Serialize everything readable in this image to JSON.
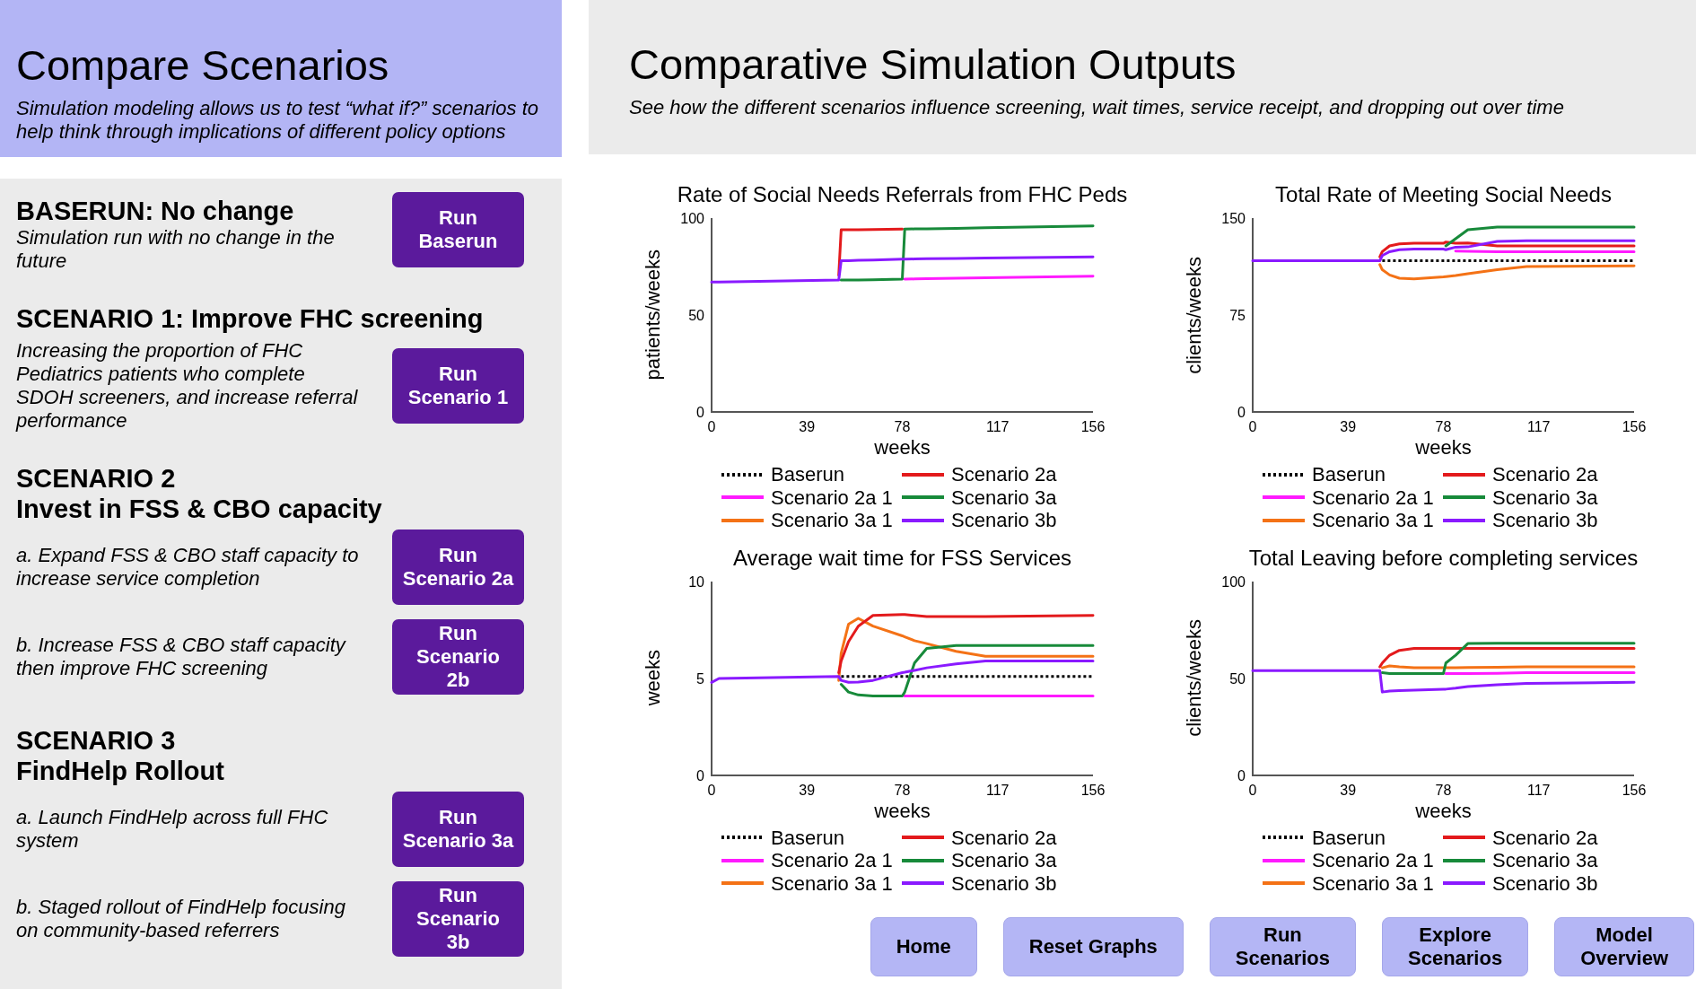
{
  "compare_panel": {
    "title": "Compare Scenarios",
    "subtitle": "Simulation modeling allows us to test “what if?” scenarios to help think through implications of different policy options"
  },
  "scenarios": [
    {
      "kind": "inline",
      "heading": "BASERUN: No change",
      "options": [
        {
          "description": "Simulation run with no change in the\nfuture",
          "button": "Run\nBaserun"
        }
      ]
    },
    {
      "kind": "stacked",
      "heading": "SCENARIO 1: Improve FHC screening",
      "options": [
        {
          "description": "Increasing the proportion of FHC\nPediatrics patients who complete\nSDOH screeners, and increase referral\nperformance",
          "button": "Run\nScenario 1"
        }
      ]
    },
    {
      "kind": "stacked",
      "heading": "SCENARIO 2\nInvest in FSS & CBO capacity",
      "options": [
        {
          "description": "a. Expand FSS & CBO staff capacity to\nincrease service completion",
          "button": "Run\nScenario 2a"
        },
        {
          "description": "b. Increase FSS & CBO staff capacity\nthen improve FHC screening",
          "button": "Run\nScenario\n2b"
        }
      ]
    },
    {
      "kind": "stacked",
      "heading": "SCENARIO 3\nFindHelp Rollout",
      "options": [
        {
          "description": "a. Launch FindHelp across full FHC\nsystem",
          "button": "Run\nScenario 3a"
        },
        {
          "description": "b. Staged rollout of FindHelp focusing\non community-based referrers",
          "button": "Run\nScenario\n3b"
        }
      ]
    }
  ],
  "outputs_header": {
    "title": "Comparative Simulation Outputs",
    "subtitle": "See how the different scenarios influence screening, wait times, service receipt, and dropping out over time"
  },
  "charts": [
    {
      "chart_data": {
        "type": "line",
        "title": "Rate of Social Needs Referrals from FHC Peds",
        "xlabel": "weeks",
        "ylabel": "patients/weeks",
        "x": [
          0,
          3,
          52,
          53,
          56,
          60,
          66,
          78,
          79,
          83,
          88,
          100,
          112,
          156
        ],
        "xlim": [
          0,
          156
        ],
        "ylim": [
          0,
          100
        ],
        "xticks": [
          0,
          39,
          78,
          117,
          156
        ],
        "yticks": [
          0,
          50,
          100
        ],
        "legend": "bottom",
        "series": [
          {
            "name": "Baserun",
            "color": "#000000",
            "line_style": "dotted",
            "values": [
              null,
              null,
              null,
              null,
              null,
              null,
              null,
              null,
              null,
              null,
              null,
              null,
              null,
              null
            ]
          },
          {
            "name": "Scenario 2a 1",
            "color": "#ff1aff",
            "line_style": "solid",
            "values": [
              null,
              null,
              null,
              null,
              null,
              null,
              null,
              null,
              68.5,
              68.6,
              68.7,
              69,
              69.2,
              70
            ]
          },
          {
            "name": "Scenario 3a 1",
            "color": "#f47216",
            "line_style": "solid",
            "values": [
              null,
              null,
              null,
              null,
              null,
              null,
              null,
              null,
              null,
              null,
              null,
              null,
              null,
              null
            ]
          },
          {
            "name": "Scenario 2a",
            "color": "#e31a1c",
            "line_style": "solid",
            "values": [
              null,
              null,
              70.5,
              94,
              94,
              94,
              94.1,
              94.3,
              null,
              null,
              null,
              null,
              null,
              null
            ]
          },
          {
            "name": "Scenario 3a",
            "color": "#178a3a",
            "line_style": "solid",
            "values": [
              null,
              null,
              null,
              68,
              68,
              68,
              68.2,
              68.5,
              94.3,
              94.4,
              94.5,
              94.7,
              95,
              96
            ]
          },
          {
            "name": "Scenario 3b",
            "color": "#8a1aff",
            "line_style": "solid",
            "values": [
              67,
              67,
              68,
              78,
              78,
              78.2,
              78.4,
              78.8,
              78.8,
              78.9,
              79,
              79.2,
              79.4,
              80
            ]
          }
        ]
      }
    },
    {
      "chart_data": {
        "type": "line",
        "title": "Total Rate of Meeting Social Needs",
        "xlabel": "weeks",
        "ylabel": "clients/weeks",
        "x": [
          0,
          3,
          52,
          53,
          56,
          60,
          66,
          78,
          79,
          83,
          88,
          100,
          112,
          156
        ],
        "xlim": [
          0,
          156
        ],
        "ylim": [
          0,
          150
        ],
        "xticks": [
          0,
          39,
          78,
          117,
          156
        ],
        "yticks": [
          0,
          75,
          150
        ],
        "legend": "bottom",
        "series": [
          {
            "name": "Baserun",
            "color": "#000000",
            "line_style": "dotted",
            "values": [
              null,
              null,
              null,
              117,
              117,
              117,
              117,
              117,
              117,
              117,
              117,
              117,
              117,
              117
            ]
          },
          {
            "name": "Scenario 2a 1",
            "color": "#ff1aff",
            "line_style": "solid",
            "values": [
              null,
              null,
              null,
              null,
              null,
              null,
              null,
              null,
              null,
              124.5,
              124.3,
              124,
              124,
              124
            ]
          },
          {
            "name": "Scenario 3a 1",
            "color": "#f47216",
            "line_style": "solid",
            "values": [
              null,
              null,
              114,
              110,
              106,
              103.5,
              103,
              104.5,
              104.7,
              105.5,
              107,
              110,
              112.5,
              113
            ]
          },
          {
            "name": "Scenario 2a",
            "color": "#e31a1c",
            "line_style": "solid",
            "values": [
              null,
              null,
              120,
              124,
              128.5,
              130,
              130.5,
              130.5,
              131.5,
              130.5,
              130.7,
              128.5,
              128.5,
              128.5
            ]
          },
          {
            "name": "Scenario 3a",
            "color": "#178a3a",
            "line_style": "solid",
            "values": [
              null,
              null,
              null,
              null,
              null,
              null,
              null,
              null,
              128.5,
              134,
              141,
              143,
              143,
              143
            ]
          },
          {
            "name": "Scenario 3b",
            "color": "#8a1aff",
            "line_style": "solid",
            "values": [
              117,
              117,
              117,
              121,
              124,
              125.5,
              126,
              126,
              125.5,
              127.5,
              127.7,
              132,
              132.5,
              132.5
            ]
          }
        ]
      }
    },
    {
      "chart_data": {
        "type": "line",
        "title": "Average wait time for FSS Services",
        "xlabel": "weeks",
        "ylabel": "weeks",
        "x": [
          0,
          3,
          52,
          53,
          56,
          60,
          66,
          78,
          79,
          83,
          88,
          100,
          112,
          156
        ],
        "xlim": [
          0,
          156
        ],
        "ylim": [
          0,
          10
        ],
        "xticks": [
          0,
          39,
          78,
          117,
          156
        ],
        "yticks": [
          0,
          5,
          10
        ],
        "legend": "bottom",
        "series": [
          {
            "name": "Baserun",
            "color": "#000000",
            "line_style": "dotted",
            "values": [
              null,
              null,
              null,
              5.1,
              5.1,
              5.1,
              5.1,
              5.1,
              5.1,
              5.1,
              5.1,
              5.1,
              5.1,
              5.1
            ]
          },
          {
            "name": "Scenario 2a 1",
            "color": "#ff1aff",
            "line_style": "solid",
            "values": [
              null,
              null,
              null,
              null,
              null,
              null,
              null,
              null,
              4.1,
              4.1,
              4.1,
              4.1,
              4.1,
              4.1
            ]
          },
          {
            "name": "Scenario 3a 1",
            "color": "#f47216",
            "line_style": "solid",
            "values": [
              null,
              null,
              4.9,
              6.3,
              7.8,
              8.1,
              7.7,
              7.2,
              7.15,
              6.95,
              6.8,
              6.4,
              6.15,
              6.15
            ]
          },
          {
            "name": "Scenario 2a",
            "color": "#e31a1c",
            "line_style": "solid",
            "values": [
              null,
              null,
              5.3,
              5.9,
              6.9,
              7.7,
              8.25,
              8.3,
              8.3,
              8.25,
              8.2,
              8.2,
              8.2,
              8.25
            ]
          },
          {
            "name": "Scenario 3a",
            "color": "#178a3a",
            "line_style": "solid",
            "values": [
              null,
              null,
              null,
              4.7,
              4.3,
              4.15,
              4.1,
              4.1,
              4.3,
              5.8,
              6.55,
              6.7,
              6.7,
              6.7
            ]
          },
          {
            "name": "Scenario 3b",
            "color": "#8a1aff",
            "line_style": "solid",
            "values": [
              4.8,
              5,
              5.1,
              4.9,
              4.8,
              4.82,
              4.9,
              5.3,
              5.32,
              5.42,
              5.55,
              5.75,
              5.9,
              5.9
            ]
          }
        ]
      }
    },
    {
      "chart_data": {
        "type": "line",
        "title": "Total Leaving before completing services",
        "xlabel": "weeks",
        "ylabel": "clients/weeks",
        "x": [
          0,
          3,
          52,
          53,
          56,
          60,
          66,
          78,
          79,
          83,
          88,
          100,
          112,
          156
        ],
        "xlim": [
          0,
          156
        ],
        "ylim": [
          0,
          100
        ],
        "xticks": [
          0,
          39,
          78,
          117,
          156
        ],
        "yticks": [
          0,
          50,
          100
        ],
        "legend": "bottom",
        "series": [
          {
            "name": "Baserun",
            "color": "#000000",
            "line_style": "dotted",
            "values": [
              null,
              null,
              null,
              null,
              null,
              null,
              null,
              null,
              null,
              null,
              null,
              null,
              null,
              null
            ]
          },
          {
            "name": "Scenario 2a 1",
            "color": "#ff1aff",
            "line_style": "solid",
            "values": [
              null,
              null,
              null,
              null,
              null,
              null,
              null,
              null,
              52.5,
              52.5,
              52.5,
              52.7,
              53,
              53
            ]
          },
          {
            "name": "Scenario 3a 1",
            "color": "#f47216",
            "line_style": "solid",
            "values": [
              null,
              null,
              null,
              55.5,
              56.5,
              56,
              55.5,
              55.5,
              55.5,
              55.5,
              55.7,
              55.8,
              56,
              56
            ]
          },
          {
            "name": "Scenario 2a",
            "color": "#e31a1c",
            "line_style": "solid",
            "values": [
              null,
              null,
              56,
              58,
              62,
              64.5,
              65.5,
              65.5,
              65.5,
              65.5,
              65.5,
              65.5,
              65.5,
              65.5
            ]
          },
          {
            "name": "Scenario 3a",
            "color": "#178a3a",
            "line_style": "solid",
            "values": [
              null,
              null,
              null,
              53,
              52.5,
              52.5,
              52.5,
              52.5,
              58,
              62,
              68,
              68.2,
              68.2,
              68.2
            ]
          },
          {
            "name": "Scenario 3b",
            "color": "#8a1aff",
            "line_style": "solid",
            "values": [
              54,
              54,
              54,
              43,
              43.5,
              43.7,
              44,
              44.5,
              44.5,
              45,
              45.8,
              46.8,
              47.5,
              48
            ]
          }
        ]
      }
    }
  ],
  "nav_buttons": [
    "Home",
    "Reset Graphs",
    "Run\nScenarios",
    "Explore\nScenarios",
    "Model\nOverview"
  ]
}
